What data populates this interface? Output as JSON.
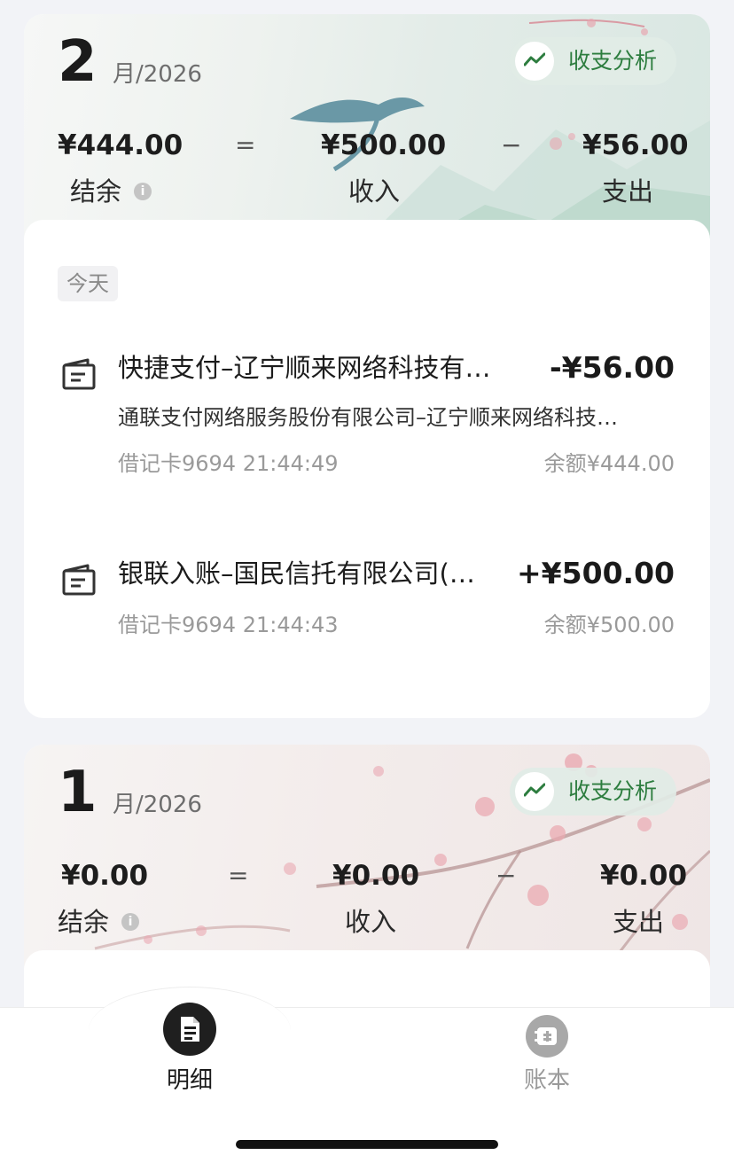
{
  "months": [
    {
      "month": "2",
      "year_suffix": "月/2026",
      "analysis_label": "收支分析",
      "balance": "¥444.00",
      "income": "¥500.00",
      "expense": "¥56.00",
      "balance_label": "结余",
      "income_label": "收入",
      "expense_label": "支出",
      "eq_sign": "=",
      "minus_sign": "−",
      "day_label": "今天",
      "transactions": [
        {
          "title": "快捷支付–辽宁顺来网络科技有…",
          "amount": "-¥56.00",
          "desc": "通联支付网络服务股份有限公司–辽宁顺来网络科技…",
          "card_time": "借记卡9694 21:44:49",
          "balance": "余额¥444.00"
        },
        {
          "title": "银联入账–国民信托有限公司(…",
          "amount": "+¥500.00",
          "card_time": "借记卡9694 21:44:43",
          "balance": "余额¥500.00"
        }
      ]
    },
    {
      "month": "1",
      "year_suffix": "月/2026",
      "analysis_label": "收支分析",
      "balance": "¥0.00",
      "income": "¥0.00",
      "expense": "¥0.00",
      "balance_label": "结余",
      "income_label": "收入",
      "expense_label": "支出",
      "eq_sign": "=",
      "minus_sign": "−"
    }
  ],
  "info_glyph": "i",
  "tabbar": {
    "items": [
      {
        "label": "明细",
        "icon": "document-icon",
        "active": true
      },
      {
        "label": "账本",
        "icon": "ledger-icon",
        "active": false
      }
    ]
  },
  "colors": {
    "accent_green": "#2d7d3f",
    "active_tab": "#1f1f1f",
    "inactive_tab": "#a8a8a8"
  }
}
